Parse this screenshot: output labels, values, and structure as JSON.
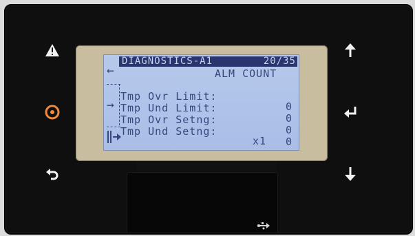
{
  "screen": {
    "header_title": "DIAGNOSTICS-A1",
    "header_page": "20/35",
    "column_header": "ALM COUNT",
    "rows": [
      {
        "label": "Tmp Ovr Limit:",
        "value": "0"
      },
      {
        "label": "Tmp Und Limit:",
        "value": "0"
      },
      {
        "label": "Tmp Ovr Setng:",
        "value": "0"
      },
      {
        "label": "Tmp Und Setng:",
        "value": "0"
      }
    ],
    "multiplier": "x1"
  },
  "buttons": {
    "left": [
      "warning-icon",
      "target-icon",
      "back-icon"
    ],
    "right": [
      "up-arrow-icon",
      "enter-icon",
      "down-arrow-icon"
    ]
  },
  "colors": {
    "lcd_bg": "#aec2ea",
    "lcd_text": "#39467c",
    "header_bg": "#2a3570",
    "bezel": "#c9bd9f",
    "panel": "#0f0f10",
    "accent_orange": "#f08a3a"
  }
}
